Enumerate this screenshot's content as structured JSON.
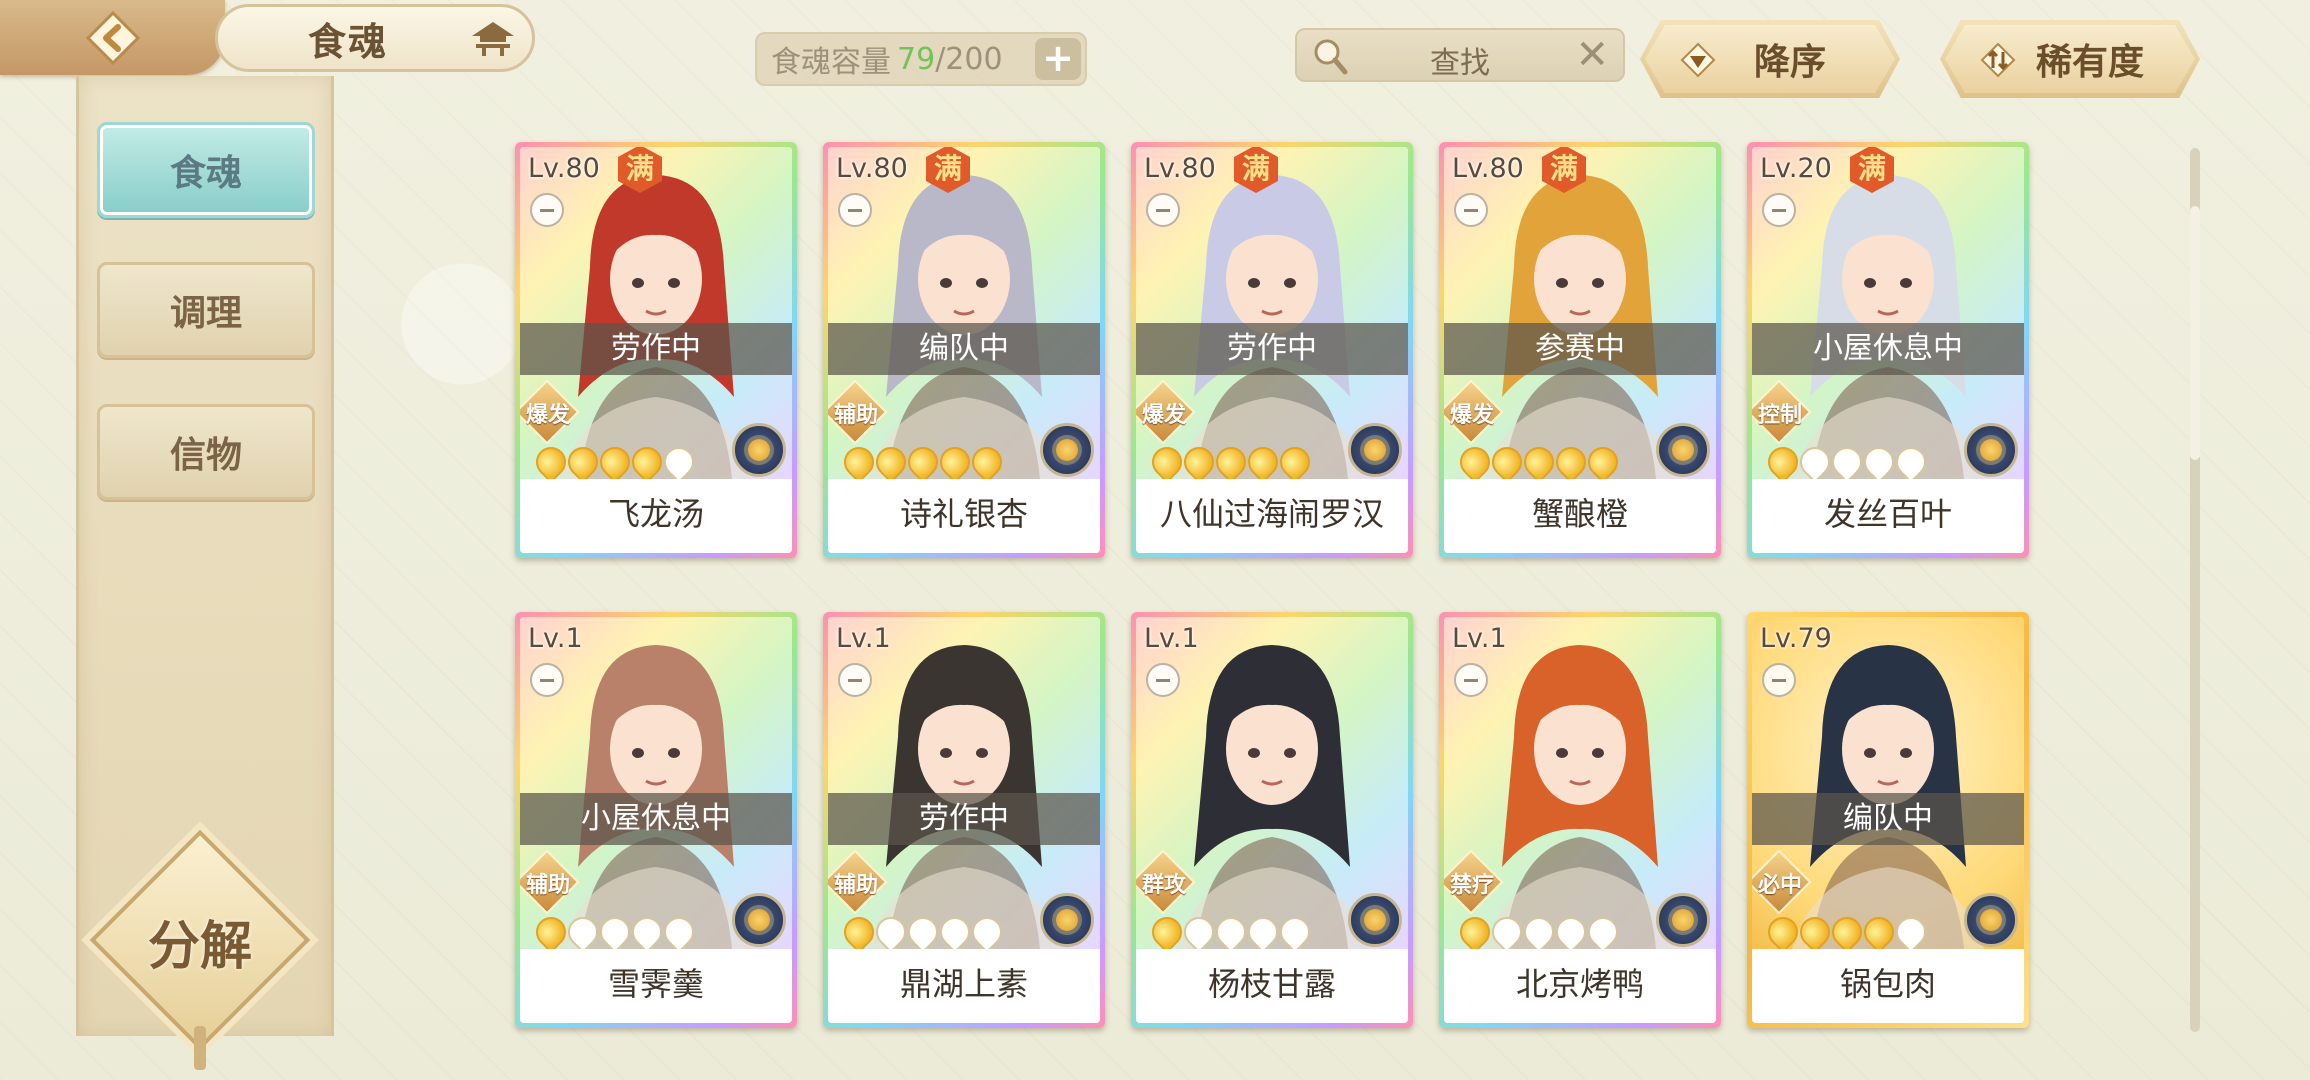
{
  "header": {
    "title": "食魂",
    "capacity_label": "食魂容量",
    "capacity_used": "79",
    "capacity_total": "/200",
    "search_placeholder": "查找",
    "sort_order_label": "降序",
    "sort_key_label": "稀有度"
  },
  "sidebar": {
    "items": [
      {
        "label": "食魂",
        "active": true
      },
      {
        "label": "调理",
        "active": false
      },
      {
        "label": "信物",
        "active": false
      }
    ],
    "decompose_label": "分解"
  },
  "cards": [
    {
      "level": "Lv.80",
      "full_badge": "满",
      "status": "劳作中",
      "role": "爆发",
      "stars": 4,
      "name": "飞龙汤",
      "frame": "rainbow",
      "hair": "#c0392b"
    },
    {
      "level": "Lv.80",
      "full_badge": "满",
      "status": "编队中",
      "role": "辅助",
      "stars": 5,
      "name": "诗礼银杏",
      "frame": "rainbow",
      "hair": "#b8b8c8"
    },
    {
      "level": "Lv.80",
      "full_badge": "满",
      "status": "劳作中",
      "role": "爆发",
      "stars": 5,
      "name": "八仙过海闹罗汉",
      "frame": "rainbow",
      "hair": "#c9cbe6"
    },
    {
      "level": "Lv.80",
      "full_badge": "满",
      "status": "参赛中",
      "role": "爆发",
      "stars": 5,
      "name": "蟹酿橙",
      "frame": "rainbow",
      "hair": "#e2a43a"
    },
    {
      "level": "Lv.20",
      "full_badge": "满",
      "status": "小屋休息中",
      "role": "控制",
      "stars": 1,
      "name": "发丝百叶",
      "frame": "rainbow",
      "hair": "#d7dde6"
    },
    {
      "level": "Lv.1",
      "full_badge": "",
      "status": "小屋休息中",
      "role": "辅助",
      "stars": 1,
      "name": "雪霁羹",
      "frame": "rainbow",
      "hair": "#b9806a"
    },
    {
      "level": "Lv.1",
      "full_badge": "",
      "status": "劳作中",
      "role": "辅助",
      "stars": 1,
      "name": "鼎湖上素",
      "frame": "rainbow",
      "hair": "#3a3530"
    },
    {
      "level": "Lv.1",
      "full_badge": "",
      "status": "",
      "role": "群攻",
      "stars": 1,
      "name": "杨枝甘露",
      "frame": "rainbow",
      "hair": "#2e2e36"
    },
    {
      "level": "Lv.1",
      "full_badge": "",
      "status": "",
      "role": "禁疗",
      "stars": 1,
      "name": "北京烤鸭",
      "frame": "rainbow",
      "hair": "#d9622b"
    },
    {
      "level": "Lv.79",
      "full_badge": "",
      "status": "编队中",
      "role": "必中",
      "stars": 4,
      "name": "锅包肉",
      "frame": "gold",
      "hair": "#283346"
    }
  ]
}
